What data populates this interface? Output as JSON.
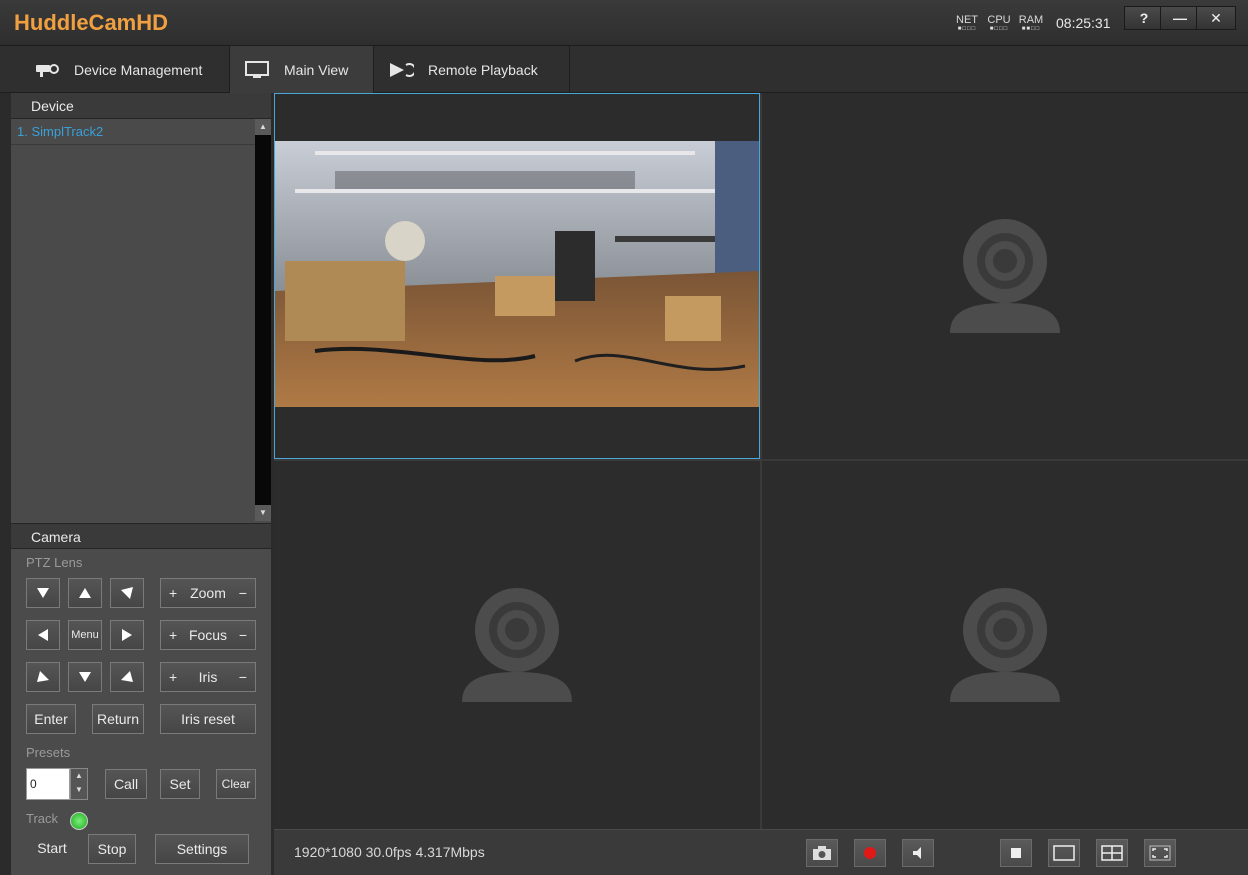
{
  "titlebar": {
    "app_title": "HuddleCamHD",
    "meters": [
      {
        "label": "NET",
        "bars": "■□□□"
      },
      {
        "label": "CPU",
        "bars": "■□□□"
      },
      {
        "label": "RAM",
        "bars": "■■□□"
      }
    ],
    "clock": "08:25:31",
    "help_label": "?",
    "minimize_label": "—",
    "close_label": "✕"
  },
  "tabs": [
    {
      "label": "Device Management",
      "icon": "camera-network-icon"
    },
    {
      "label": "Main View",
      "icon": "monitor-icon",
      "active": true
    },
    {
      "label": "Remote Playback",
      "icon": "playback-icon"
    }
  ],
  "device": {
    "header": "Device",
    "items": [
      {
        "label": "1. SimplTrack2"
      }
    ]
  },
  "camera": {
    "header": "Camera",
    "ptz_lens_label": "PTZ Lens",
    "menu_label": "Menu",
    "zoom_label": "Zoom",
    "focus_label": "Focus",
    "iris_label": "Iris",
    "plus": "+",
    "minus": "−",
    "enter_label": "Enter",
    "return_label": "Return",
    "iris_reset_label": "Iris reset",
    "presets_label": "Presets",
    "preset_value": "0",
    "call_label": "Call",
    "set_label": "Set",
    "clear_label": "Clear",
    "track_label": "Track",
    "start_label": "Start",
    "stop_label": "Stop",
    "settings_label": "Settings"
  },
  "bottombar": {
    "stream_info": "1920*1080 30.0fps 4.317Mbps"
  },
  "colors": {
    "accent": "#f0a040",
    "selection": "#4aa8d8",
    "device_link": "#3aa0d8",
    "record": "#e01818",
    "track_ok": "#1ea61e"
  }
}
